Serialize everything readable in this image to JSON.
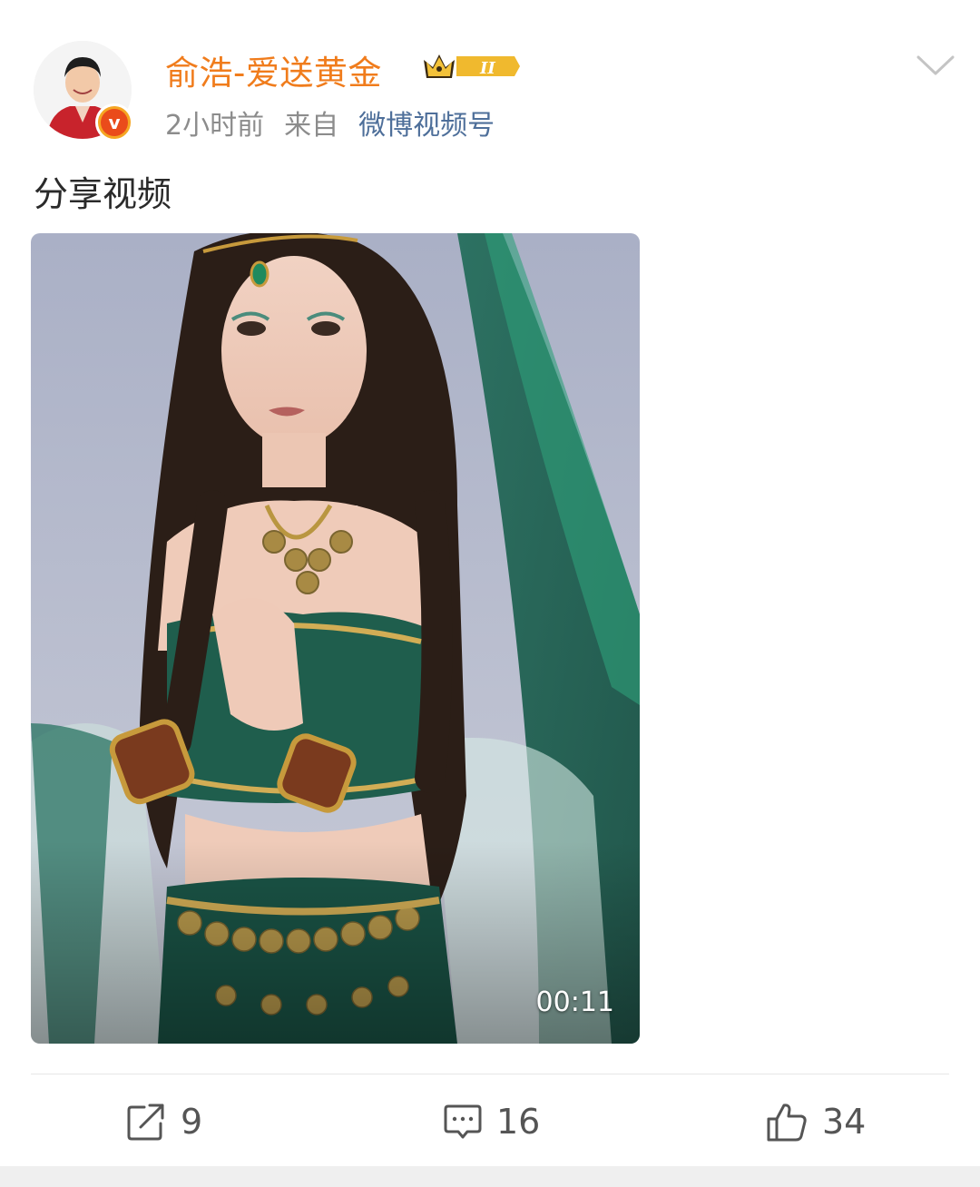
{
  "post": {
    "author": "俞浩-爱送黄金",
    "vip_level": "II",
    "time": "2小时前",
    "from_label": "来自",
    "source": "微博视频号",
    "text": "分享视频",
    "video_duration": "00:11"
  },
  "actions": {
    "repost_count": "9",
    "comment_count": "16",
    "like_count": "34"
  },
  "colors": {
    "username": "#f07c1c",
    "source_link": "#4e6f9a",
    "verified_badge": "#f5a623"
  }
}
